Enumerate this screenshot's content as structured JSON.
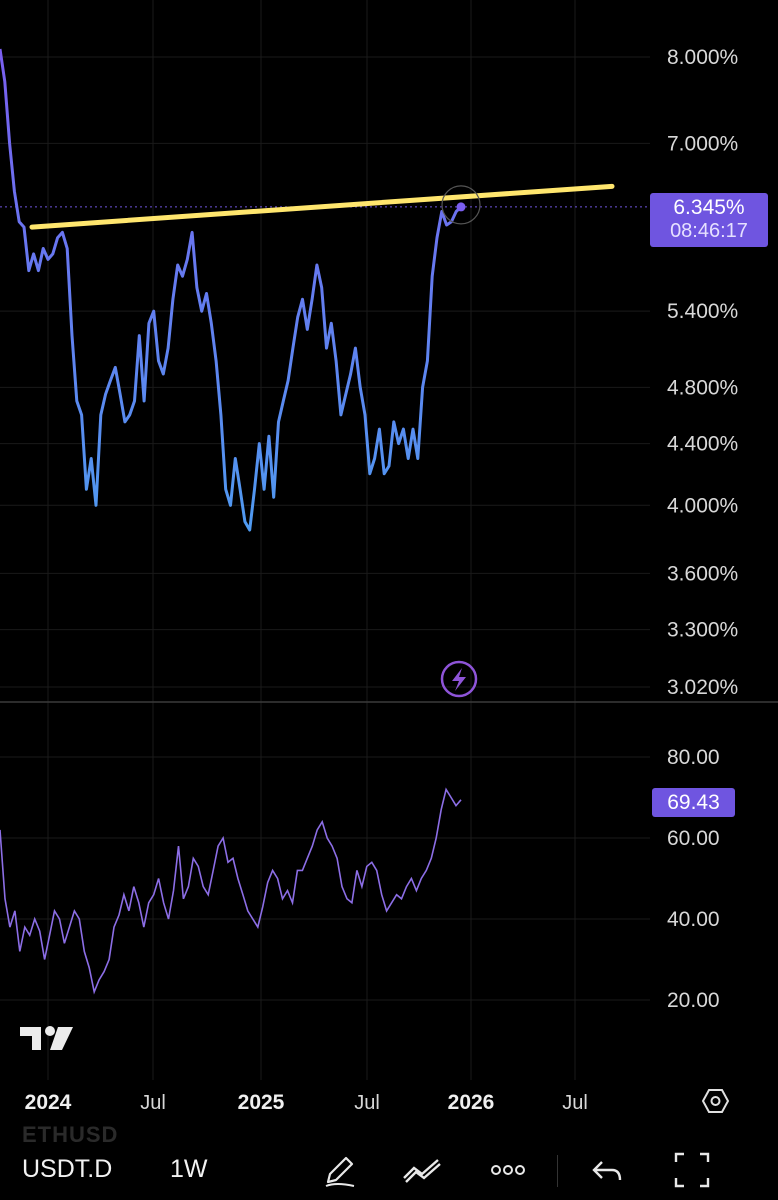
{
  "symbol": "USDT.D",
  "timeframe": "1W",
  "ghost_symbol": "ETHUSD",
  "price_badge": {
    "value": "6.345%",
    "countdown": "08:46:17"
  },
  "rsi_badge": {
    "value": "69.43"
  },
  "colors": {
    "price_line": "#6f7bf0",
    "trendline": "#ffe66e",
    "rsi_line": "#8c6ee6",
    "badge": "#6f55e0",
    "background": "#000000",
    "grid": "#1a1a1a"
  },
  "icons": [
    "tradingview-logo",
    "lightning-icon",
    "settings-hexagon-icon",
    "pencil-icon",
    "indicators-icon",
    "more-icon",
    "undo-icon",
    "fullscreen-icon"
  ],
  "chart_data": [
    {
      "type": "line",
      "scale": "log",
      "y_ticks": [
        "8.000%",
        "7.000%",
        "6.345%",
        "5.400%",
        "4.800%",
        "4.400%",
        "4.000%",
        "3.600%",
        "3.300%",
        "3.020%"
      ],
      "x_ticks": [
        "2024",
        "Jul",
        "2025",
        "Jul",
        "2026",
        "Jul"
      ],
      "series": [
        {
          "values": [
            8.1,
            7.7,
            7.0,
            6.5,
            6.2,
            6.15,
            5.75,
            5.9,
            5.75,
            5.95,
            5.85,
            5.9,
            6.05,
            6.1,
            5.95,
            5.2,
            4.7,
            4.6,
            4.1,
            4.3,
            4.0,
            4.6,
            4.75,
            4.85,
            4.95,
            4.75,
            4.55,
            4.6,
            4.7,
            5.2,
            4.7,
            5.3,
            5.4,
            5.0,
            4.9,
            5.1,
            5.5,
            5.8,
            5.7,
            5.85,
            6.1,
            5.6,
            5.4,
            5.55,
            5.3,
            5.0,
            4.6,
            4.1,
            4.0,
            4.3,
            4.1,
            3.9,
            3.85,
            4.1,
            4.4,
            4.1,
            4.45,
            4.05,
            4.55,
            4.7,
            4.85,
            5.1,
            5.35,
            5.5,
            5.25,
            5.5,
            5.8,
            5.6,
            5.1,
            5.3,
            5.0,
            4.6,
            4.75,
            4.9,
            5.1,
            4.8,
            4.6,
            4.2,
            4.3,
            4.5,
            4.2,
            4.25,
            4.55,
            4.4,
            4.5,
            4.3,
            4.5,
            4.3,
            4.8,
            5.0,
            5.7,
            6.05,
            6.3,
            6.17,
            6.2,
            6.3,
            6.345
          ]
        }
      ],
      "trendline": {
        "start": [
          0,
          6.15
        ],
        "end": [
          96,
          6.55
        ]
      },
      "last_value": "6.345%"
    },
    {
      "type": "line",
      "y_ticks": [
        "80.00",
        "60.00",
        "40.00",
        "20.00"
      ],
      "ylim": [
        10,
        90
      ],
      "series": [
        {
          "values": [
            62,
            45,
            38,
            42,
            32,
            38,
            36,
            40,
            37,
            30,
            36,
            42,
            40,
            34,
            38,
            42,
            40,
            32,
            28,
            22,
            25,
            27,
            30,
            38,
            41,
            46,
            42,
            48,
            44,
            38,
            44,
            46,
            50,
            44,
            40,
            47,
            58,
            45,
            48,
            55,
            53,
            48,
            46,
            52,
            58,
            60,
            54,
            55,
            50,
            46,
            42,
            40,
            38,
            43,
            49,
            52,
            50,
            45,
            47,
            44,
            52,
            52,
            55,
            58,
            62,
            64,
            60,
            58,
            55,
            48,
            45,
            44,
            52,
            48,
            53,
            54,
            52,
            46,
            42,
            44,
            46,
            45,
            48,
            50,
            47,
            50,
            52,
            55,
            60,
            67,
            72,
            70,
            68,
            69.43
          ]
        }
      ]
    }
  ]
}
